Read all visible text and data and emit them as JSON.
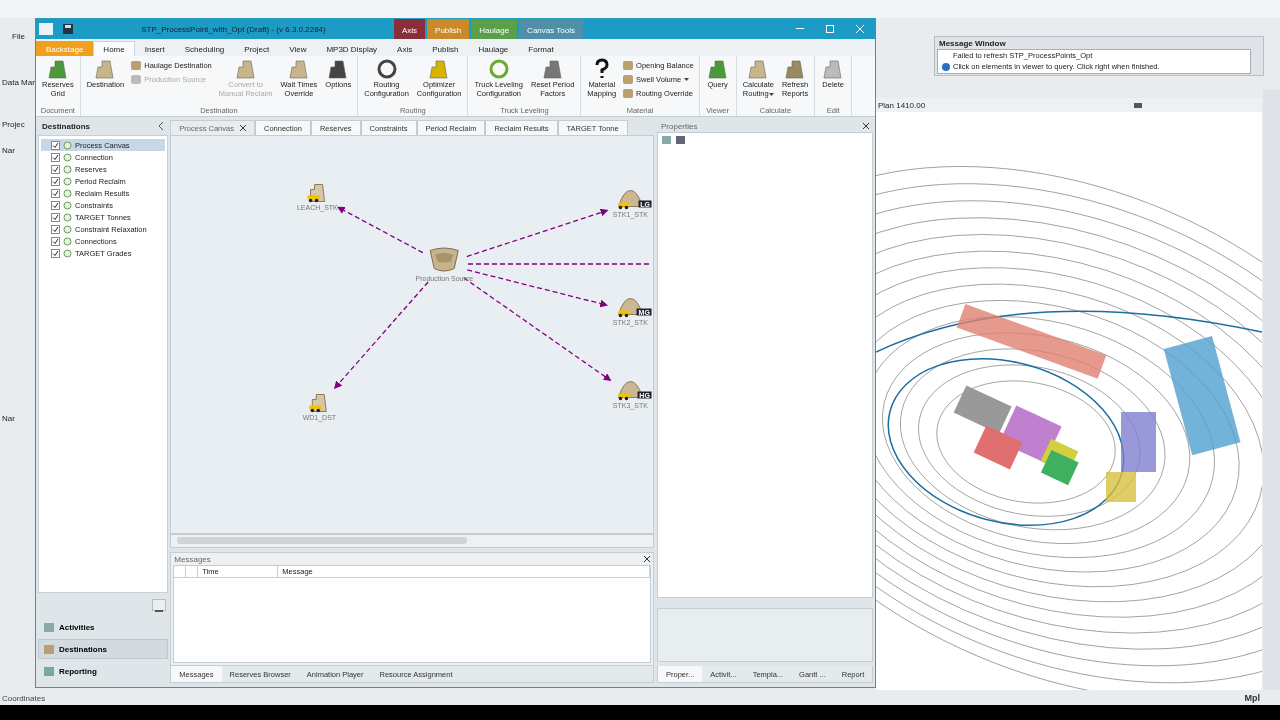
{
  "host": {
    "menu": [
      "File"
    ],
    "side_labels": [
      "Data Mar",
      "Projec",
      "Nar",
      "Nar"
    ],
    "message_window": {
      "title": "Message Window",
      "lines": [
        {
          "text": "Failed to refresh STP_ProcessPoints_Opt",
          "kind": "plain"
        },
        {
          "text": "Click on elements in viewer to query.  Click right when finished.",
          "kind": "info"
        }
      ]
    },
    "view_title": "Plan 1410.00",
    "status_bar": "Coordinates",
    "tray": "Mpl"
  },
  "window": {
    "title": "STP_ProcessPoint_with_Opt (Draft) - (v 6.3.0.2284)",
    "contextual_tabs": [
      {
        "label": "Axis",
        "color": "#8a2f3a"
      },
      {
        "label": "Publish",
        "color": "#c98a2a"
      },
      {
        "label": "Haulage",
        "color": "#5aa04a"
      },
      {
        "label": "Canvas Tools",
        "color": "#4f8fa8"
      }
    ]
  },
  "ribbon_tabs": [
    {
      "label": "Backstage",
      "kind": "backstage",
      "selected": false
    },
    {
      "label": "Home",
      "kind": "tab",
      "selected": true
    },
    {
      "label": "Insert",
      "kind": "tab",
      "selected": false
    },
    {
      "label": "Scheduling",
      "kind": "tab",
      "selected": false
    },
    {
      "label": "Project",
      "kind": "tab",
      "selected": false
    },
    {
      "label": "View",
      "kind": "tab",
      "selected": false
    },
    {
      "label": "MP3D Display",
      "kind": "tab",
      "selected": false
    },
    {
      "label": "Axis",
      "kind": "tab",
      "selected": false
    },
    {
      "label": "Publish",
      "kind": "tab",
      "selected": false
    },
    {
      "label": "Haulage",
      "kind": "tab",
      "selected": false
    },
    {
      "label": "Format",
      "kind": "tab",
      "selected": false
    }
  ],
  "ribbon_groups": [
    {
      "label": "Document",
      "items": [
        {
          "kind": "large",
          "lines": [
            "Reserves",
            "Grid"
          ],
          "disabled": false
        }
      ]
    },
    {
      "label": "Destination",
      "items": [
        {
          "kind": "large",
          "lines": [
            "Destination"
          ],
          "disabled": false
        },
        {
          "kind": "small",
          "lines": [
            "Haulage Destination"
          ],
          "disabled": false
        },
        {
          "kind": "small",
          "lines": [
            "Production Source"
          ],
          "disabled": true
        },
        {
          "kind": "large",
          "lines": [
            "Convert to",
            "Manual Reclaim"
          ],
          "disabled": true
        },
        {
          "kind": "large",
          "lines": [
            "Wait Times",
            "Override"
          ],
          "disabled": false
        },
        {
          "kind": "large",
          "lines": [
            "Options"
          ],
          "disabled": false
        }
      ]
    },
    {
      "label": "Routing",
      "items": [
        {
          "kind": "large",
          "lines": [
            "Routing",
            "Configuration"
          ],
          "disabled": false
        },
        {
          "kind": "large",
          "lines": [
            "Optimizer",
            "Configuration"
          ],
          "disabled": false
        }
      ]
    },
    {
      "label": "Truck Leveling",
      "items": [
        {
          "kind": "large",
          "lines": [
            "Truck Leveling",
            "Configuration"
          ],
          "disabled": false
        },
        {
          "kind": "large",
          "lines": [
            "Reset Period",
            "Factors"
          ],
          "disabled": false
        }
      ]
    },
    {
      "label": "Material",
      "items": [
        {
          "kind": "large",
          "lines": [
            "Material",
            "Mapping"
          ],
          "disabled": false
        },
        {
          "kind": "small",
          "lines": [
            "Opening Balance"
          ],
          "disabled": false
        },
        {
          "kind": "small",
          "lines": [
            "Swell Volume"
          ],
          "disabled": false,
          "dropdown": true
        },
        {
          "kind": "small",
          "lines": [
            "Routing Override"
          ],
          "disabled": false
        }
      ]
    },
    {
      "label": "Viewer",
      "items": [
        {
          "kind": "large",
          "lines": [
            "Query"
          ],
          "disabled": false
        }
      ]
    },
    {
      "label": "Calculate",
      "items": [
        {
          "kind": "large",
          "lines": [
            "Calculate",
            "Routing"
          ],
          "disabled": false,
          "dropdown": true
        },
        {
          "kind": "large",
          "lines": [
            "Refresh",
            "Reports"
          ],
          "disabled": false
        }
      ]
    },
    {
      "label": "Edit",
      "items": [
        {
          "kind": "large",
          "lines": [
            "Delete"
          ],
          "disabled": false
        }
      ]
    }
  ],
  "destinations_panel": {
    "title": "Destinations",
    "items": [
      {
        "label": "Process Canvas",
        "checked": true,
        "selected": true
      },
      {
        "label": "Connection",
        "checked": true,
        "selected": false
      },
      {
        "label": "Reserves",
        "checked": true,
        "selected": false
      },
      {
        "label": "Period Reclaim",
        "checked": true,
        "selected": false
      },
      {
        "label": "Reclaim Results",
        "checked": true,
        "selected": false
      },
      {
        "label": "Constraints",
        "checked": true,
        "selected": false
      },
      {
        "label": "TARGET Tonnes",
        "checked": true,
        "selected": false
      },
      {
        "label": "Constraint Relaxation",
        "checked": true,
        "selected": false
      },
      {
        "label": "Connections",
        "checked": true,
        "selected": false
      },
      {
        "label": "TARGET Grades",
        "checked": true,
        "selected": false
      }
    ]
  },
  "nav_buttons": [
    {
      "label": "Activities",
      "selected": false
    },
    {
      "label": "Destinations",
      "selected": true
    },
    {
      "label": "Reporting",
      "selected": false
    }
  ],
  "document_tabs": [
    {
      "label": "Process Canvas",
      "selected": true
    },
    {
      "label": "Connection",
      "selected": false
    },
    {
      "label": "Reserves",
      "selected": false
    },
    {
      "label": "Constraints",
      "selected": false
    },
    {
      "label": "Period Reclaim",
      "selected": false
    },
    {
      "label": "Reclaim Results",
      "selected": false
    },
    {
      "label": "TARGET Tonne",
      "selected": false
    }
  ],
  "canvas": {
    "nodes": [
      {
        "label": "LEACH_STK",
        "kind": "dump"
      },
      {
        "label": "Production Source",
        "kind": "source"
      },
      {
        "label": "STK1_STK",
        "kind": "stockpile",
        "badge": "LG"
      },
      {
        "label": "STK2_STK",
        "kind": "stockpile",
        "badge": "MG"
      },
      {
        "label": "STK3_STK",
        "kind": "stockpile",
        "badge": "HG"
      },
      {
        "label": "WD1_DST",
        "kind": "dump"
      }
    ],
    "offscreen_connector": {
      "kind": "dashed"
    }
  },
  "messages": {
    "title": "Messages",
    "columns": [
      "Time",
      "Message"
    ],
    "tabs": [
      {
        "label": "Messages",
        "selected": true
      },
      {
        "label": "Reserves Browser",
        "selected": false
      },
      {
        "label": "Animation Player",
        "selected": false
      },
      {
        "label": "Resource Assignment",
        "selected": false
      }
    ]
  },
  "properties": {
    "title": "Properties",
    "tabs": [
      {
        "label": "Proper...",
        "selected": true
      },
      {
        "label": "Activit...",
        "selected": false
      },
      {
        "label": "Templa...",
        "selected": false
      },
      {
        "label": "Gantt ...",
        "selected": false
      },
      {
        "label": "Report",
        "selected": false
      }
    ]
  }
}
